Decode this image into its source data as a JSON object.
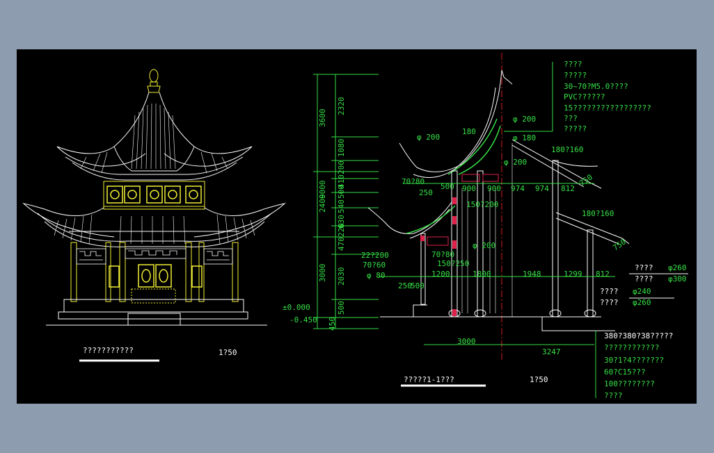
{
  "colors": {
    "background": "#8e9cb0",
    "sheet": "#000000",
    "line_white": "#ffffff",
    "line_yellow": "#f2ef34",
    "dim_green": "#36e046",
    "accent_red": "#e0224a",
    "accent_magenta": "#ff2fb7",
    "center_red": "#d21b1b"
  },
  "elevation": {
    "title": "???????????",
    "scale": "1?50"
  },
  "section": {
    "title": "?????1-1???",
    "scale": "1?50",
    "vertical_dims": {
      "outer_total": "9000",
      "outer_a": "3600",
      "outer_b": "2400",
      "outer_c": "3000",
      "outer_d": "450",
      "inner_a": "2320",
      "inner_b": "1080",
      "inner_c": "200",
      "inner_d": "410",
      "inner_e": "500",
      "inner_f": "540",
      "inner_g": "630",
      "inner_h": "220",
      "inner_i": "470",
      "inner_j": "2030",
      "inner_k": "500"
    },
    "levels": [
      "±0.000",
      "-0.450"
    ],
    "upper_dims": [
      "500",
      "900",
      "900",
      "974",
      "974",
      "812",
      "250"
    ],
    "lower_dims": [
      "250",
      "500",
      "1200",
      "1800",
      "1948",
      "1299",
      "812"
    ],
    "bottom_dims": [
      "3000",
      "3247"
    ],
    "member_labels": [
      "φ 200",
      "180",
      "φ 200",
      "φ 180",
      "φ 200",
      "180?160",
      "750",
      "70?80",
      "150?200",
      "180?160",
      "750",
      "70?80",
      "150?250",
      "φ 200",
      "22?200",
      "70?60",
      "φ 80"
    ],
    "roof_notes": [
      "????",
      "?????",
      "30~70?M5.0????",
      "PVC??????",
      "15?????????????????",
      "???",
      "?????"
    ],
    "column_notes": [
      {
        "text": "????",
        "dim": "φ260"
      },
      {
        "text": "????",
        "dim": "φ300"
      },
      {
        "text": "????",
        "dim": "φ240"
      },
      {
        "text": "????",
        "dim": "φ260"
      }
    ],
    "foundation_notes": [
      "380?380?38?????",
      "????????????",
      "30?1?4???????",
      "60?C15???",
      "100????????",
      "????"
    ]
  }
}
